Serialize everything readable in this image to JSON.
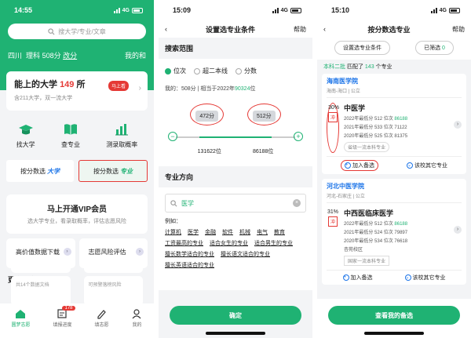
{
  "p1": {
    "time": "14:55",
    "network": "4G",
    "search_placeholder": "搜大学/专业/文章",
    "province": "四川",
    "subject": "理科",
    "score": "508分",
    "change": "改分",
    "my_link": "我的和",
    "card_title_pre": "能上的大学",
    "card_count": "149",
    "card_title_post": "所",
    "card_sub": "含211大学，双一流大学",
    "card_pill": "马上看",
    "grid": [
      "找大学",
      "查专业",
      "测录取概率"
    ],
    "seg1_label": "按分数选",
    "seg1_tag": "大学",
    "seg2_label": "按分数选",
    "seg2_tag": "专业",
    "vip_title": "马上开通VIP会员",
    "vip_sub": "选大学专业，看录取概率，评估志愿风险",
    "box1_title": "高价值数据下载",
    "box1_sub": "共14个数据文档",
    "box2_title": "志愿风险评估",
    "box2_sub": "可预警落榜风险",
    "more": "更多查询",
    "tabs": [
      "圆梦志愿",
      "填报进度",
      "填志愿",
      "我的"
    ],
    "tab_badge": "178"
  },
  "p2": {
    "time": "15:09",
    "network": "4G",
    "title": "设置选专业条件",
    "help": "帮助",
    "sec_range": "搜索范围",
    "radios": [
      "位次",
      "超二本线",
      "分数"
    ],
    "my_label": "我的：508分",
    "my_sep": "|",
    "my_equiv_pre": "相当于2022年",
    "my_rank": "90324",
    "my_rank_unit": "位",
    "score_low": "472分",
    "score_high": "512分",
    "rank_low": "131622位",
    "rank_high": "86188位",
    "sec_major": "专业方向",
    "search_value": "医学",
    "eg": "例如：",
    "tags": [
      "计算机",
      "医学",
      "金融",
      "软件",
      "机械",
      "电气",
      "教育",
      "工资最高的专业",
      "适合女生的专业",
      "适合男生的专业",
      "擅长数学适合的专业",
      "擅长语文适合的专业",
      "擅长英语适合的专业"
    ],
    "confirm": "确定"
  },
  "p3": {
    "time": "15:10",
    "network": "4G",
    "title": "按分数选专业",
    "help": "帮助",
    "tab1": "设置选专业条件",
    "tab2_label": "已筛选",
    "tab2_count": "0",
    "match_pre": "本科二批",
    "match_mid": "匹配了",
    "match_count": "143",
    "match_post": "个专业",
    "cards": [
      {
        "uni": "海南医学院",
        "loc": "海南-海口 | 公立",
        "pct": "30%",
        "tag": "冲",
        "major": "中医学",
        "rows": [
          {
            "y": "2022年最低分",
            "s": "512",
            "r": "86188"
          },
          {
            "y": "2021年最低分",
            "s": "533",
            "r": "71122"
          },
          {
            "y": "2020年最低分",
            "s": "525",
            "r": "81375"
          }
        ],
        "level": "省级一流本科专业",
        "add": "加入备选",
        "other": "该校其它专业"
      },
      {
        "uni": "河北中医学院",
        "loc": "河北-石家庄 | 公立",
        "pct": "31%",
        "tag": "冲",
        "major": "中西医临床医学",
        "rows": [
          {
            "y": "2022年最低分",
            "s": "512",
            "r": "86188"
          },
          {
            "y": "2021年最低分",
            "s": "524",
            "r": "79897"
          },
          {
            "y": "2020年最低分",
            "s": "534",
            "r": "76618"
          }
        ],
        "level": "国家一流本科专业",
        "campus": "杏苑校区",
        "add": "加入备选",
        "other": "该校其它专业"
      }
    ],
    "rank_word": "位次",
    "bottom": "查看我的备选"
  }
}
